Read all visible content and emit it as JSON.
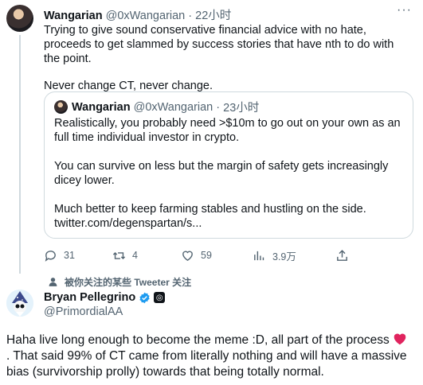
{
  "tweet": {
    "author_name": "Wangarian",
    "author_handle": "@0xWangarian",
    "separator": "·",
    "time": "22小时",
    "more_icon": "more-icon",
    "body_line1": "Trying to give sound conservative financial advice with no hate, proceeds to get slammed by success stories that have nth to do with the point.",
    "body_line2": "Never change CT, never change.",
    "quote": {
      "author_name": "Wangarian",
      "author_handle": "@0xWangarian",
      "separator": "·",
      "time": "23小时",
      "para1": "Realistically, you probably need >$10m to go out on your own as an full time individual investor in crypto.",
      "para2": "You can survive on less but the margin of safety gets increasingly dicey lower.",
      "para3": "Much better to keep farming stables and hustling on the side.",
      "link": "twitter.com/degenspartan/s..."
    },
    "actions": {
      "replies": "31",
      "retweets": "4",
      "likes": "59",
      "views": "3.9万"
    }
  },
  "social_context": "被你关注的某些 Tweeter 关注",
  "reply": {
    "author_name": "Bryan Pellegrino",
    "author_handle": "@PrimordialAA",
    "body": "Haha live long enough to become the meme :D, all part of the process",
    "body2": ". That said 99% of CT came from literally nothing and will have a massive bias (survivorship prolly) towards that being totally normal."
  },
  "colors": {
    "text": "#0f1419",
    "muted": "#536471",
    "border": "#cfd9de",
    "verified": "#1d9bf0",
    "heart": "#e0245e"
  }
}
